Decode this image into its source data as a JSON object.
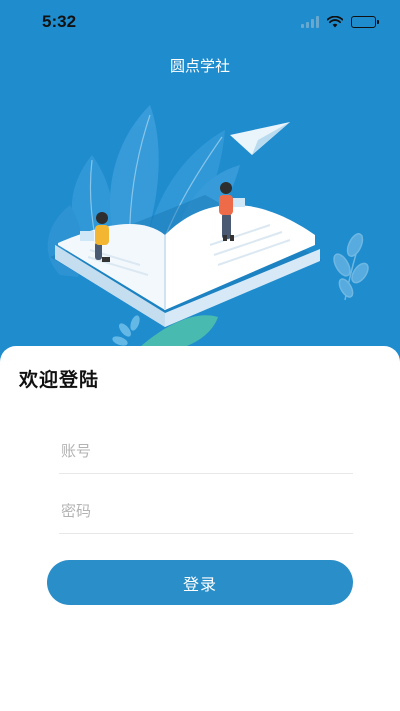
{
  "status_bar": {
    "time": "5:32"
  },
  "nav": {
    "title": "圆点学社"
  },
  "login": {
    "heading": "欢迎登陆",
    "account_placeholder": "账号",
    "password_placeholder": "密码",
    "submit_label": "登录"
  },
  "colors": {
    "primary": "#1f8cce",
    "button": "#2a8ec8",
    "card": "#ffffff"
  },
  "icons": [
    "signal-icon",
    "wifi-icon",
    "battery-icon",
    "paper-plane-icon",
    "open-book-illustration"
  ]
}
